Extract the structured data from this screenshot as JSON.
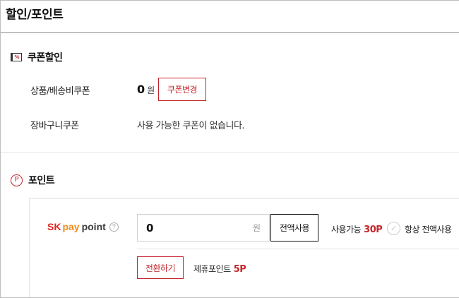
{
  "page": {
    "title": "할인/포인트"
  },
  "coupon_section": {
    "icon": "coupon-percent-icon",
    "icon_text": "%",
    "heading": "쿠폰할인",
    "product_coupon": {
      "label": "상품/배송비쿠폰",
      "amount": "0",
      "unit": "원",
      "change_button": "쿠폰변경"
    },
    "cart_coupon": {
      "label": "장바구니쿠폰",
      "message": "사용 가능한 쿠폰이 없습니다."
    }
  },
  "point_section": {
    "icon": "point-circle-icon",
    "icon_text": "P",
    "heading": "포인트",
    "sk_pay_point": {
      "logo_sk": "SK",
      "logo_pay": "pay",
      "logo_point": "point",
      "help_icon_text": "?",
      "input_value": "0",
      "input_unit": "원",
      "use_all_button": "전액사용",
      "available_label": "사용가능",
      "available_amount": "30P",
      "always_use_all_label": "항상 전액사용",
      "convert_button": "전환하기",
      "partner_points_label": "제휴포인트",
      "partner_points_amount": "5P"
    }
  },
  "colors": {
    "accent": "#c4252b",
    "sk_red": "#e0261f",
    "pay_orange": "#ef8a1c"
  }
}
